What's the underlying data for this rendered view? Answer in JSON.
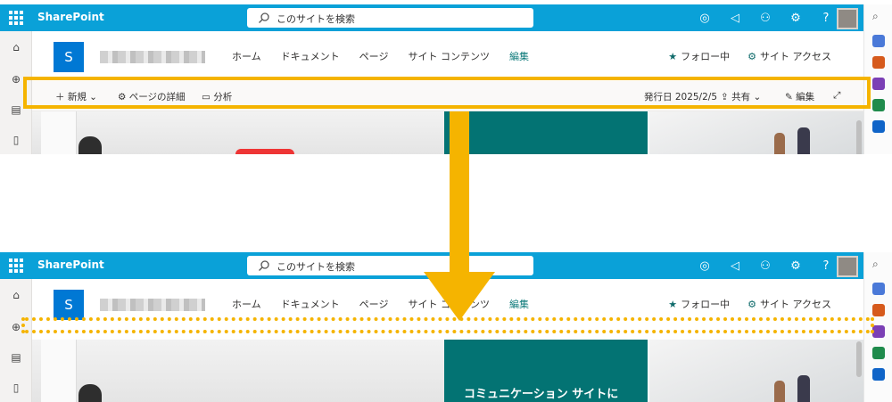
{
  "suite": {
    "app_name": "SharePoint",
    "search_placeholder": "このサイトを検索",
    "help_label": "?"
  },
  "site": {
    "logo_letter": "S",
    "nav": [
      "ホーム",
      "ドキュメント",
      "ページ",
      "サイト コンテンツ",
      "編集"
    ],
    "follow_label": "フォロー中",
    "access_label": "サイト アクセス"
  },
  "command_bar": {
    "new_label": "新規",
    "page_details_label": "ページの詳細",
    "analytics_label": "分析",
    "published_label": "発行日 2025/2/5",
    "share_label": "共有",
    "edit_label": "編集"
  },
  "hero": {
    "title": "コミュニケーション サイトに"
  },
  "colors": {
    "suite_bar": "#0aa1d8",
    "highlight": "#f5b400",
    "hero_tile": "#037373",
    "site_logo": "#0078d4"
  },
  "icons": [
    "waffle-icon",
    "search-icon",
    "copilot-icon",
    "megaphone-icon",
    "people-icon",
    "gear-icon",
    "home-icon",
    "globe-icon",
    "news-icon",
    "document-icon",
    "star-icon",
    "share-icon",
    "pencil-icon",
    "expand-icon",
    "arrow-down-icon"
  ]
}
